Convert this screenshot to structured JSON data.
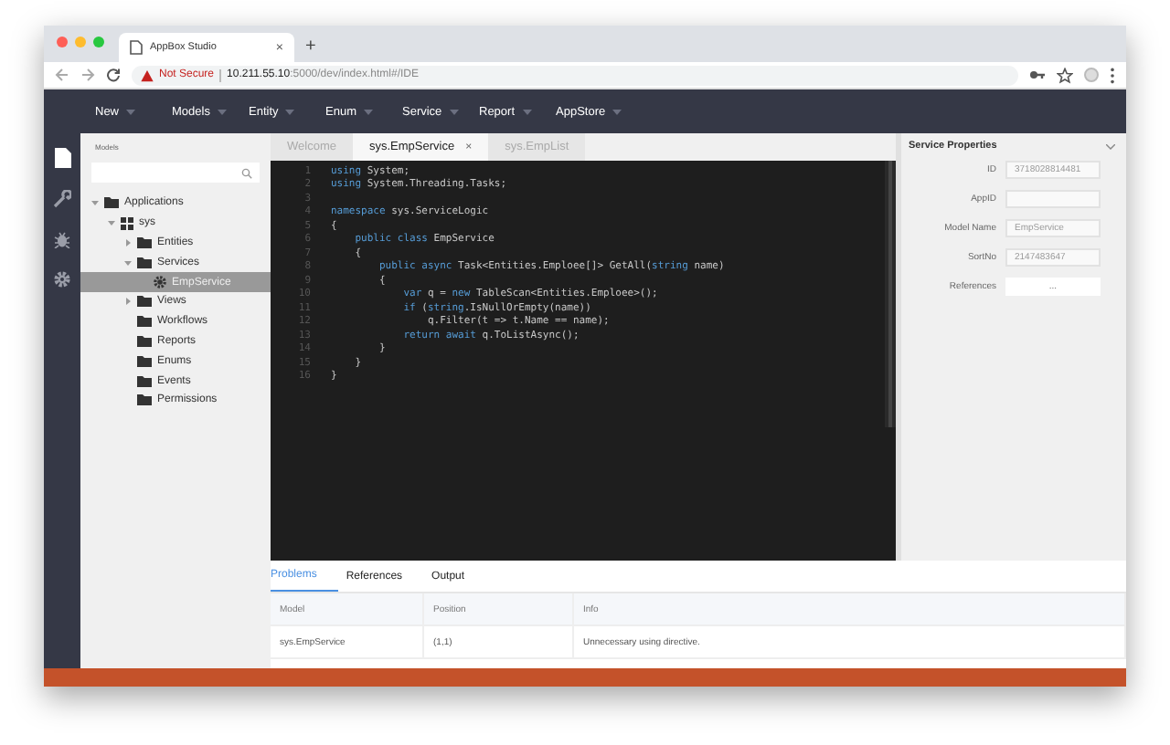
{
  "browser": {
    "tab_title": "AppBox Studio",
    "tab_close": "×",
    "new_tab": "+",
    "security": "Not Secure",
    "url_host": "10.211.55.10",
    "url_path": ":5000/dev/index.html#/IDE"
  },
  "menu": [
    {
      "label": "New"
    },
    {
      "label": "Models"
    },
    {
      "label": "Entity"
    },
    {
      "label": "Enum"
    },
    {
      "label": "Service"
    },
    {
      "label": "Report"
    },
    {
      "label": "AppStore"
    }
  ],
  "sidebar": {
    "title": "Models",
    "tree": [
      {
        "label": "Applications",
        "kind": "folder",
        "expanded": true,
        "selected": false,
        "children": [
          {
            "label": "sys",
            "kind": "app",
            "expanded": true,
            "selected": false,
            "children": [
              {
                "label": "Entities",
                "kind": "folder",
                "expanded": false,
                "selected": false
              },
              {
                "label": "Services",
                "kind": "folder",
                "expanded": true,
                "selected": false,
                "children": [
                  {
                    "label": "EmpService",
                    "kind": "service",
                    "selected": true
                  }
                ]
              },
              {
                "label": "Views",
                "kind": "folder",
                "expanded": false,
                "selected": false
              },
              {
                "label": "Workflows",
                "kind": "folder",
                "selected": false
              },
              {
                "label": "Reports",
                "kind": "folder",
                "selected": false
              },
              {
                "label": "Enums",
                "kind": "folder",
                "selected": false
              },
              {
                "label": "Events",
                "kind": "folder",
                "selected": false
              },
              {
                "label": "Permissions",
                "kind": "folder",
                "selected": false
              }
            ]
          }
        ]
      }
    ]
  },
  "editor": {
    "tabs": [
      {
        "label": "Welcome",
        "selected": false
      },
      {
        "label": "sys.EmpService",
        "selected": true,
        "close": "×"
      },
      {
        "label": "sys.EmpList",
        "selected": false
      }
    ],
    "lines": [
      {
        "number": "1",
        "segments": [
          {
            "text": "using",
            "kind": "keyword"
          },
          {
            "text": " System;",
            "kind": "plain"
          }
        ]
      },
      {
        "number": "2",
        "segments": [
          {
            "text": "using",
            "kind": "keyword"
          },
          {
            "text": " System.Threading.Tasks;",
            "kind": "plain"
          }
        ]
      },
      {
        "number": "3"
      },
      {
        "number": "4",
        "segments": [
          {
            "text": "namespace",
            "kind": "keyword"
          },
          {
            "text": " sys.ServiceLogic",
            "kind": "plain"
          }
        ]
      },
      {
        "number": "5",
        "segments": [
          {
            "text": "{",
            "kind": "plain"
          }
        ]
      },
      {
        "number": "6",
        "segments": [
          {
            "text": "    public class",
            "kind": "keyword"
          },
          {
            "text": " EmpService",
            "kind": "plain"
          }
        ]
      },
      {
        "number": "7",
        "segments": [
          {
            "text": "    {",
            "kind": "plain"
          }
        ]
      },
      {
        "number": "8",
        "segments": [
          {
            "text": "        public async",
            "kind": "keyword"
          },
          {
            "text": " Task<Entities.Emploee[]> GetAll(",
            "kind": "plain"
          },
          {
            "text": "string",
            "kind": "keyword"
          },
          {
            "text": " name)",
            "kind": "plain"
          }
        ]
      },
      {
        "number": "9",
        "segments": [
          {
            "text": "        {",
            "kind": "plain"
          }
        ]
      },
      {
        "number": "10",
        "segments": [
          {
            "text": "            var",
            "kind": "keyword"
          },
          {
            "text": " q = ",
            "kind": "plain"
          },
          {
            "text": "new",
            "kind": "keyword"
          },
          {
            "text": " TableScan<Entities.Emploee>();",
            "kind": "plain"
          }
        ]
      },
      {
        "number": "11",
        "segments": [
          {
            "text": "            if",
            "kind": "keyword"
          },
          {
            "text": " (",
            "kind": "plain"
          },
          {
            "text": "string",
            "kind": "keyword"
          },
          {
            "text": ".IsNullOrEmpty(name))",
            "kind": "plain"
          }
        ]
      },
      {
        "number": "12",
        "segments": [
          {
            "text": "                q.Filter(t => t.Name == name);",
            "kind": "plain"
          }
        ]
      },
      {
        "number": "13",
        "segments": [
          {
            "text": "            return await",
            "kind": "keyword"
          },
          {
            "text": " q.ToListAsync();",
            "kind": "plain"
          }
        ]
      },
      {
        "number": "14",
        "segments": [
          {
            "text": "        }",
            "kind": "plain"
          }
        ]
      },
      {
        "number": "15",
        "segments": [
          {
            "text": "    }",
            "kind": "plain"
          }
        ]
      },
      {
        "number": "16",
        "segments": [
          {
            "text": "}",
            "kind": "plain"
          }
        ]
      }
    ]
  },
  "properties": {
    "title": "Service Properties",
    "fields": [
      {
        "label": "ID",
        "value": "3718028814481",
        "kind": "input"
      },
      {
        "label": "AppID",
        "kind": "input"
      },
      {
        "label": "Model Name",
        "value": "EmpService",
        "kind": "input"
      },
      {
        "label": "SortNo",
        "value": "2147483647",
        "kind": "input"
      },
      {
        "label": "References",
        "value": "...",
        "kind": "button"
      }
    ]
  },
  "bottom": {
    "tabs": [
      {
        "label": "Problems",
        "selected": true
      },
      {
        "label": "References",
        "selected": false
      },
      {
        "label": "Output",
        "selected": false
      }
    ],
    "columns": [
      "Model",
      "Position",
      "Info"
    ],
    "rows": [
      [
        "sys.EmpService",
        "(1,1)",
        "Unnecessary using directive."
      ]
    ]
  }
}
